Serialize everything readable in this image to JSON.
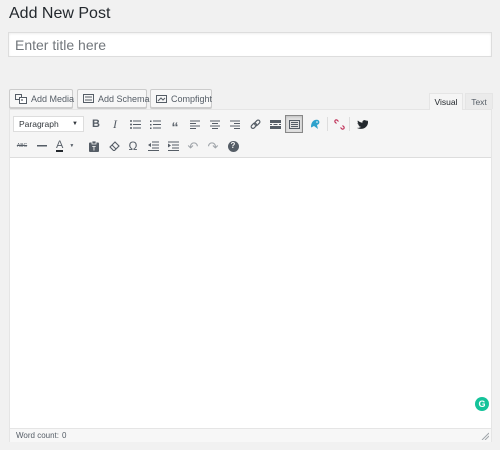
{
  "page": {
    "title": "Add New Post"
  },
  "title_field": {
    "placeholder": "Enter title here",
    "value": ""
  },
  "media_buttons": [
    {
      "label": "Add Media",
      "icon": "media-icon"
    },
    {
      "label": "Add Schema",
      "icon": "schema-icon"
    },
    {
      "label": "Compfight",
      "icon": "compfight-icon"
    }
  ],
  "tabs": {
    "visual": "Visual",
    "text": "Text",
    "active": "visual"
  },
  "toolbar": {
    "format_select": "Paragraph",
    "row1_icons": [
      "bold-icon",
      "italic-icon",
      "bulleted-list-icon",
      "numbered-list-icon",
      "blockquote-icon",
      "align-left-icon",
      "align-center-icon",
      "align-right-icon",
      "insert-link-icon",
      "read-more-icon",
      "toolbar-toggle-icon",
      "grammarly-bird-icon",
      "unlink-icon",
      "twitter-icon"
    ],
    "row2_icons": [
      "strikethrough-icon",
      "horizontal-line-icon",
      "text-color-icon",
      "paste-as-text-icon",
      "clear-formatting-icon",
      "special-character-icon",
      "decrease-indent-icon",
      "increase-indent-icon",
      "undo-icon",
      "redo-icon",
      "keyboard-shortcuts-icon"
    ],
    "glyphs": {
      "bold": "B",
      "italic": "I",
      "blockquote": "“",
      "strikethrough": "ABC",
      "text_color": "A",
      "special_char": "Ω",
      "undo": "↶",
      "redo": "↷",
      "help": "?",
      "grammarly": "G"
    }
  },
  "status": {
    "word_count_label": "Word count:",
    "word_count": "0"
  },
  "colors": {
    "accent": "#15c39a",
    "twitter": "#23282d",
    "unlink": "#c1345b",
    "bird": "#2ea2cc"
  }
}
